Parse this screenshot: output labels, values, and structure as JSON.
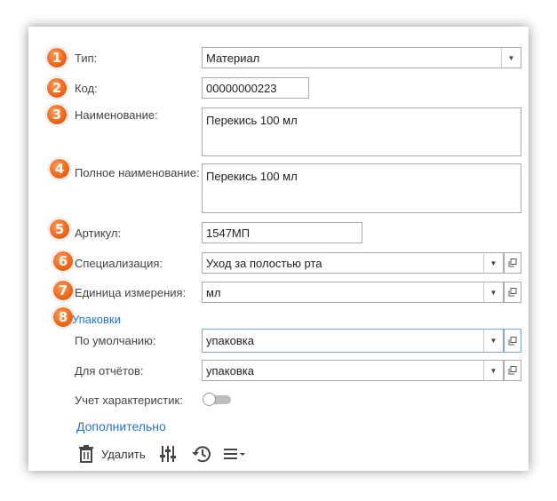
{
  "fields": {
    "type": {
      "badge": "1",
      "label": "Тип:",
      "value": "Материал"
    },
    "code": {
      "badge": "2",
      "label": "Код:",
      "value": "00000000223"
    },
    "name": {
      "badge": "3",
      "label": "Наименование:",
      "value": "Перекись 100 мл"
    },
    "full_name": {
      "badge": "4",
      "label": "Полное наименование:",
      "value": "Перекись 100 мл"
    },
    "article": {
      "badge": "5",
      "label": "Артикул:",
      "value": "1547МП"
    },
    "specialization": {
      "badge": "6",
      "label": "Специализация:",
      "value": "Уход за полостью рта"
    },
    "unit": {
      "badge": "7",
      "label": "Единица измерения:",
      "value": "мл"
    }
  },
  "packaging": {
    "badge": "8",
    "title": "Упаковки",
    "default": {
      "label": "По умолчанию:",
      "value": "упаковка"
    },
    "reports": {
      "label": "Для отчётов:",
      "value": "упаковка"
    },
    "characteristics": {
      "label": "Учет характеристик:",
      "enabled": false
    }
  },
  "more_link": "Дополнительно",
  "toolbar": {
    "delete_label": "Удалить",
    "icons": [
      "trash-icon",
      "sliders-icon",
      "history-icon",
      "menu-icon"
    ]
  },
  "colors": {
    "badge": "#f06a1c",
    "link": "#2a72c8",
    "focus_border": "#7aa7d8"
  }
}
